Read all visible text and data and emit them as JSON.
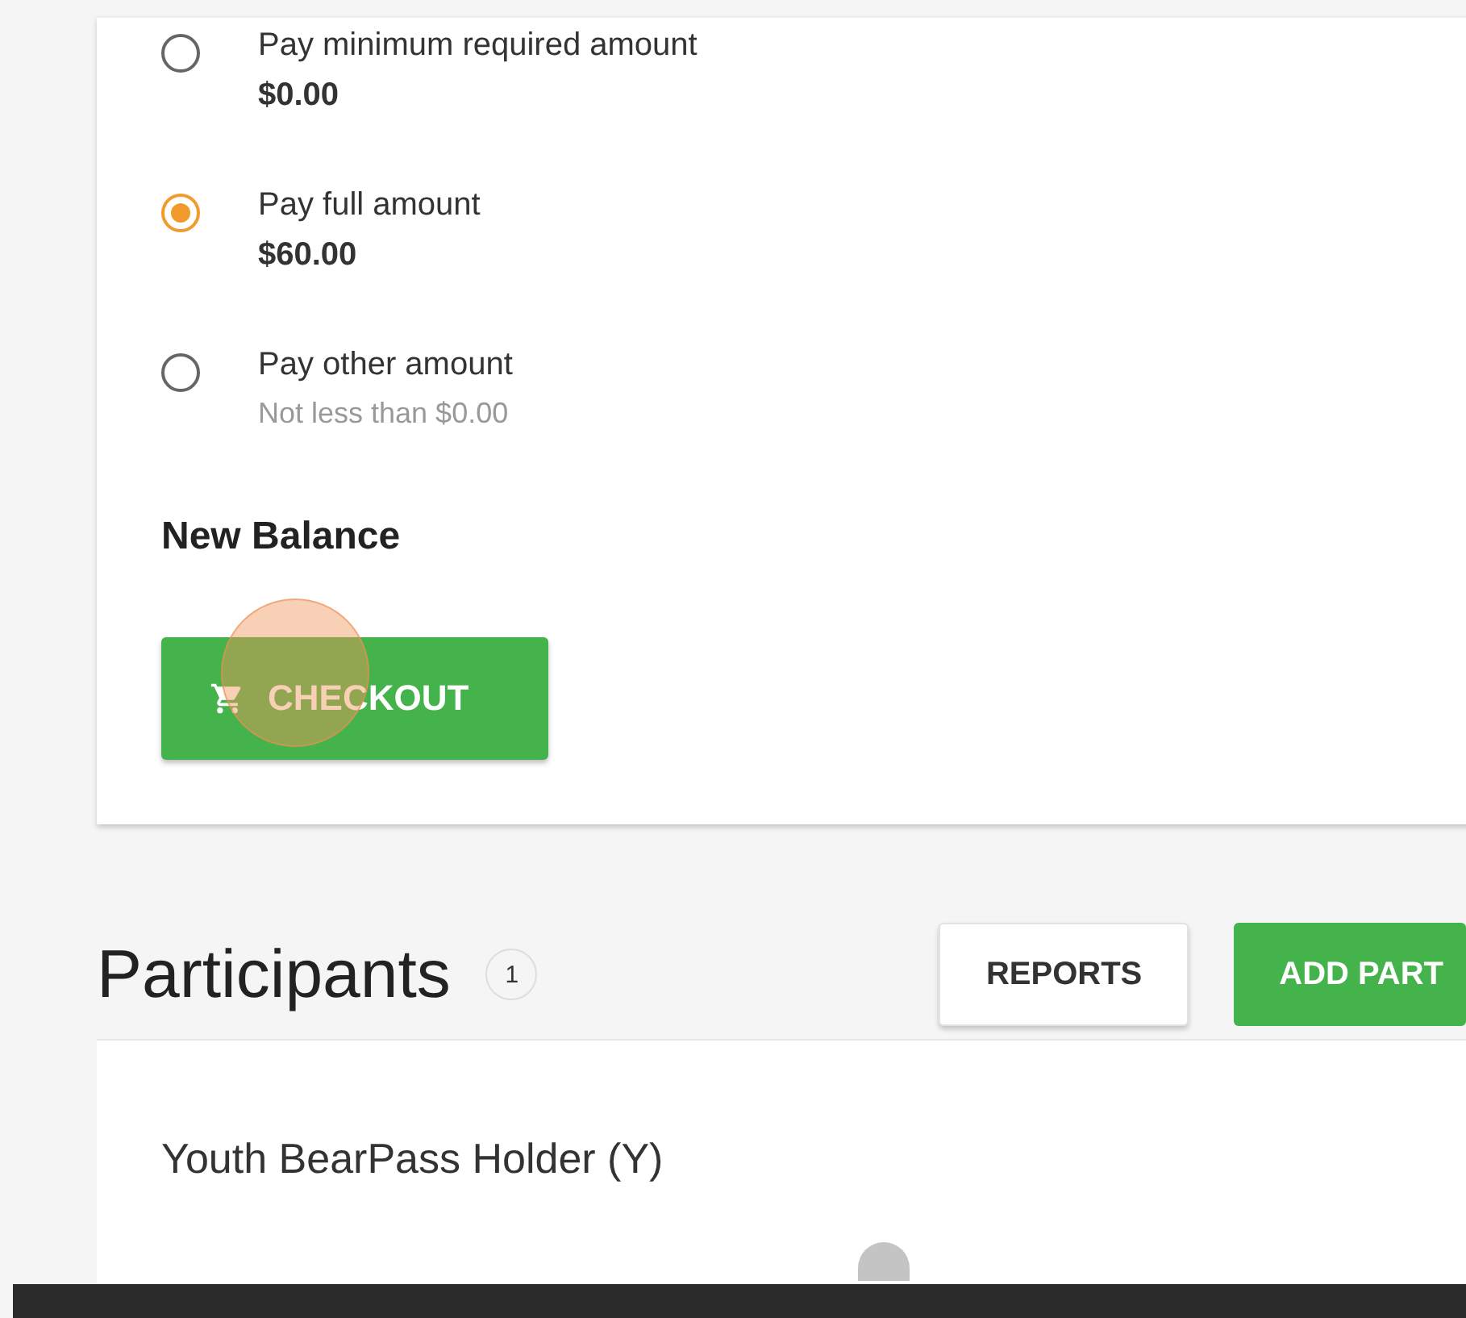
{
  "payment_options": [
    {
      "label": "Pay minimum required amount",
      "detail": "$0.00",
      "kind": "amount",
      "selected": false
    },
    {
      "label": "Pay full amount",
      "detail": "$60.00",
      "kind": "amount",
      "selected": true
    },
    {
      "label": "Pay other amount",
      "detail": "Not less than $0.00",
      "kind": "hint",
      "selected": false
    }
  ],
  "new_balance_label": "New Balance",
  "checkout_button": "CHECKOUT",
  "participants": {
    "title": "Participants",
    "count": "1",
    "buttons": [
      {
        "label": "REPORTS",
        "kind": "outlined"
      },
      {
        "label": "ADD PART",
        "kind": "primary"
      }
    ],
    "card_title": "Youth BearPass Holder (Y)"
  }
}
